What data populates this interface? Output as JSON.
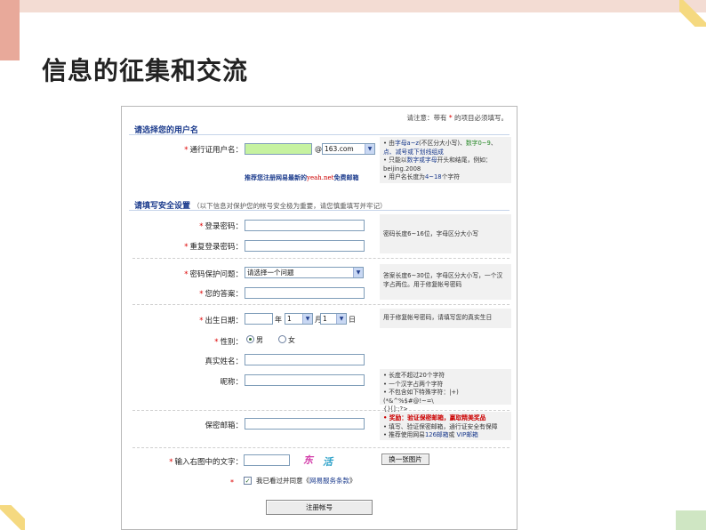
{
  "slide": {
    "title": "信息的征集和交流"
  },
  "form": {
    "top_note_pre": "请注意：带有",
    "top_note_star": "*",
    "top_note_post": "的项目必须填写。",
    "section1_title": "请选择您的用户名",
    "section2_title": "请填写安全设置",
    "section2_sub": "（以下信息对保护您的帐号安全极为重要，请您慎重填写并牢记）",
    "star": "*",
    "username_label": "通行证用户名：",
    "at_sign": "@",
    "domain_value": "163.com",
    "username_hint": {
      "line1_pre": "• 由",
      "line1_a": "字母a~z",
      "line1_mid": "(不区分大小写)、",
      "line1_b": "数字0~9",
      "line1_c": "、",
      "line2": "点、减号或下划线组成",
      "line3_pre": "• 只能以",
      "line3_b": "数字或字母",
      "line3_post": "开头和结尾，例如：",
      "line4": "beijing.2008",
      "line5_pre": "• 用户名长度为",
      "line5_b": "4~18",
      "line5_post": "个字符"
    },
    "rec_link_pre": "推荐您注册网易最新的",
    "rec_link_mid": "yeah.net",
    "rec_link_post": "免费邮箱",
    "password_label": "登录密码：",
    "password_repeat_label": "重复登录密码：",
    "password_hint": "密码长度6~16位，字母区分大小写",
    "question_label": "密码保护问题：",
    "question_value": "请选择一个问题",
    "answer_label": "您的答案：",
    "question_hint": "答案长度6~30位，字母区分大小写，一个汉字占两位。用于修复帐号密码",
    "birthday_label": "出生日期：",
    "year_unit": "年",
    "month_value": "1",
    "month_unit": "月",
    "day_value": "1",
    "day_unit": "日",
    "birthday_hint": "用于修复帐号密码，请填写您的真实生日",
    "gender_label": "性别：",
    "gender_male": "男",
    "gender_female": "女",
    "realname_label": "真实姓名：",
    "nickname_label": "昵称：",
    "nickname_hint": {
      "line1": "• 长度不超过20个字符",
      "line2": "• 一个汉字占两个字符",
      "line3": "• 不包含如下特殊字符：|+)(*&^%$#@!~=\\",
      "line4": "{}[]:;?>"
    },
    "secmail_label": "保密邮箱：",
    "secmail_hint": {
      "line1_pre": "• 奖励：",
      "line1_b": "验证保密邮箱，赢取精美奖品",
      "line2": "• 填写、验证保密邮箱，通行证安全有保障",
      "line3_pre": "• 推荐使用网易",
      "line3_b": "126邮箱",
      "line3_mid": "或 ",
      "line3_c": "VIP邮箱"
    },
    "captcha_label": "输入右图中的文字：",
    "captcha_char1": "东",
    "captcha_char2": "活",
    "captcha_button": "换一张图片",
    "agree_pre": "我已看过并同意《",
    "agree_link": "网易服务条款",
    "agree_post": "》",
    "submit_button": "注册帐号"
  },
  "colors": {
    "section_title": "#1a3a8c",
    "required_star": "#dd0000",
    "username_field": "#c6f2a0",
    "hint_background": "#f1f1f1"
  },
  "icons": [
    "chevron-down-icon",
    "radio-icon",
    "checkbox-icon"
  ]
}
